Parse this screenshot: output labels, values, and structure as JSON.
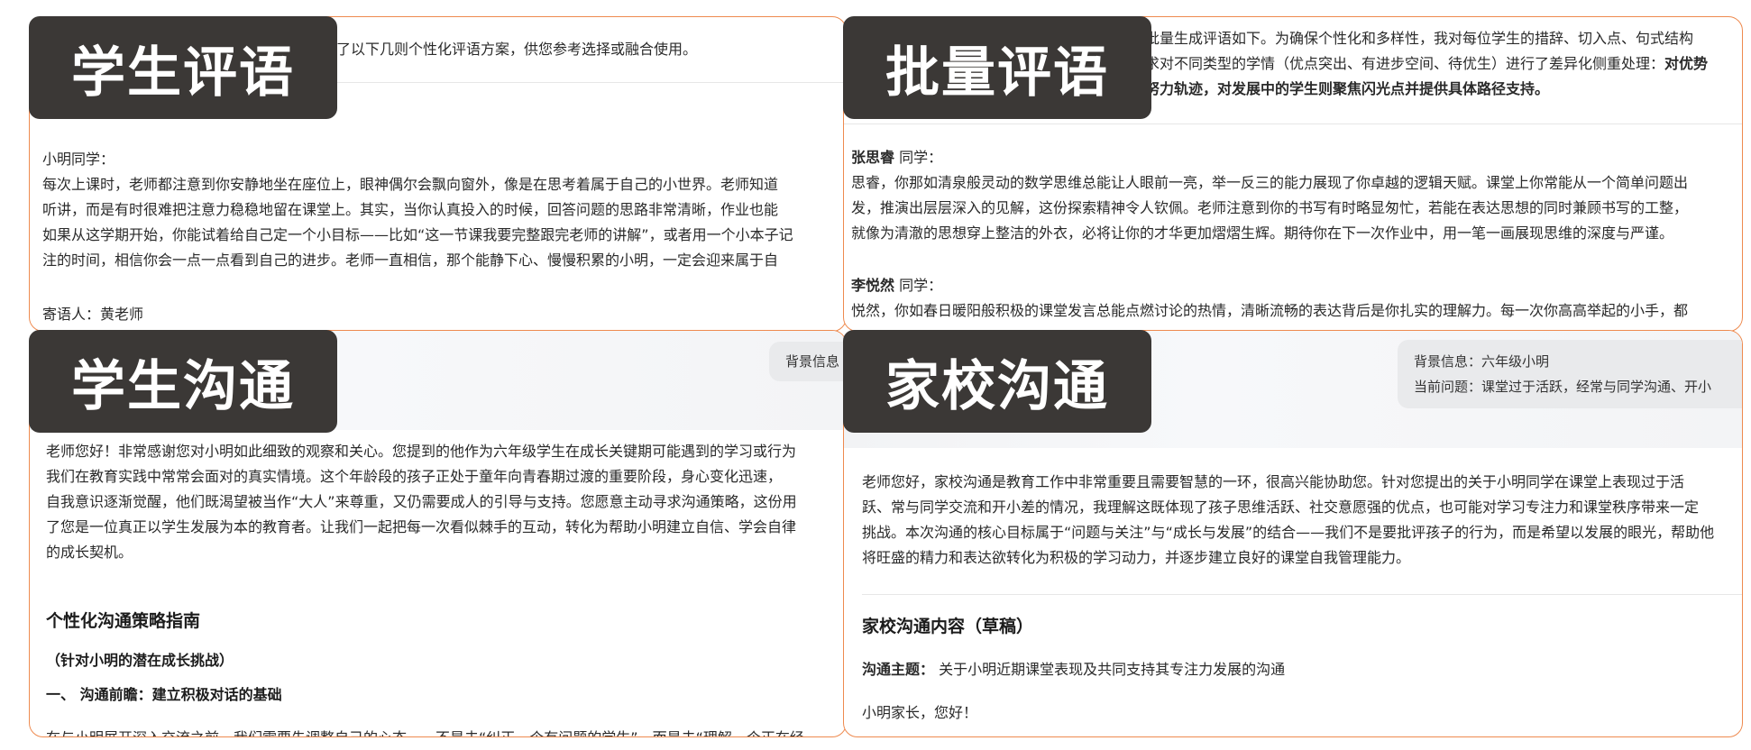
{
  "tags": {
    "student_comment": "学生评语",
    "batch_comment": "批量评语",
    "student_communication": "学生沟通",
    "home_school": "家校沟通"
  },
  "panel1": {
    "intro": "了以下几则个性化评语方案，供您参考选择或融合使用。",
    "greeting": "小明同学：",
    "body": [
      "每次上课时，老师都注意到你安静地坐在座位上，眼神偶尔会飘向窗外，像是在思考着属于自己的小世界。老师知道",
      "听讲，而是有时很难把注意力稳稳地留在课堂上。其实，当你认真投入的时候，回答问题的思路非常清晰，作业也能",
      "如果从这学期开始，你能试着给自己定一个小目标——比如“这一节课我要完整跟完老师的讲解”，或者用一个小本子记",
      "注的时间，相信你会一点一点看到自己的进步。老师一直相信，那个能静下心、慢慢积累的小明，一定会迎来属于自"
    ],
    "signature": "寄语人：黄老师"
  },
  "panel2": {
    "intro1": "批量生成评语如下。为确保个性化和多样性，我对每位学生的措辞、切入点、句式结构",
    "intro2_pre": "求对不同类型的学情（优点突出、有进步空间、待优生）进行了差异化侧重处理：",
    "intro2_bold": "对优势",
    "intro3_bold": "努力轨迹，对发展中的学生则聚焦闪光点并提供具体路径支持。",
    "student1_name": "张思睿",
    "student1_suffix": " 同学：",
    "student1_body": [
      "思睿，你那如清泉般灵动的数学思维总能让人眼前一亮，举一反三的能力展现了你卓越的逻辑天赋。课堂上你常能从一个简单问题出",
      "发，推演出层层深入的见解，这份探索精神令人钦佩。老师注意到你的书写有时略显匆忙，若能在表达思想的同时兼顾书写的工整，",
      "就像为清澈的思想穿上整洁的外衣，必将让你的才华更加熠熠生辉。期待你在下一次作业中，用一笔一画展现思维的深度与严谨。"
    ],
    "student2_name": "李悦然",
    "student2_suffix": " 同学：",
    "student2_body": "悦然，你如春日暖阳般积极的课堂发言总能点燃讨论的热情，清晰流畅的表达背后是你扎实的理解力。每一次你高高举起的小手，都"
  },
  "panel3": {
    "bubble": "背景信息",
    "body": [
      "老师您好！非常感谢您对小明如此细致的观察和关心。您提到的他作为六年级学生在成长关键期可能遇到的学习或行为",
      "我们在教育实践中常常会面对的真实情境。这个年龄段的孩子正处于童年向青春期过渡的重要阶段，身心变化迅速，",
      "自我意识逐渐觉醒，他们既渴望被当作“大人”来尊重，又仍需要成人的引导与支持。您愿意主动寻求沟通策略，这份用",
      "了您是一位真正以学生发展为本的教育者。让我们一起把每一次看似棘手的互动，转化为帮助小明建立自信、学会自律",
      "的成长契机。"
    ],
    "heading": "个性化沟通策略指南",
    "subheading": "（针对小明的潜在成长挑战）",
    "section": "一、 沟通前瞻：建立积极对话的基础",
    "cutoff": "在与小明展开深入交流之前，我们需要先调整自己的心态——不是去“纠正一个有问题的学生”，而是去“理解一个正在经"
  },
  "panel4": {
    "bubble_line1": "背景信息：六年级小明",
    "bubble_line2": "当前问题：课堂过于活跃，经常与同学沟通、开小",
    "body": [
      "老师您好，家校沟通是教育工作中非常重要且需要智慧的一环，很高兴能协助您。针对您提出的关于小明同学在课堂上表现过于活",
      "跃、常与同学交流和开小差的情况，我理解这既体现了孩子思维活跃、社交意愿强的优点，也可能对学习专注力和课堂秩序带来一定",
      "挑战。本次沟通的核心目标属于“问题与关注”与“成长与发展”的结合——我们不是要批评孩子的行为，而是希望以发展的眼光，帮助他",
      "将旺盛的精力和表达欲转化为积极的学习动力，并逐步建立良好的课堂自我管理能力。"
    ],
    "heading": "家校沟通内容（草稿）",
    "topic_label": "沟通主题：",
    "topic_value": " 关于小明近期课堂表现及共同支持其专注力发展的沟通",
    "salutation": "小明家长，您好！"
  }
}
